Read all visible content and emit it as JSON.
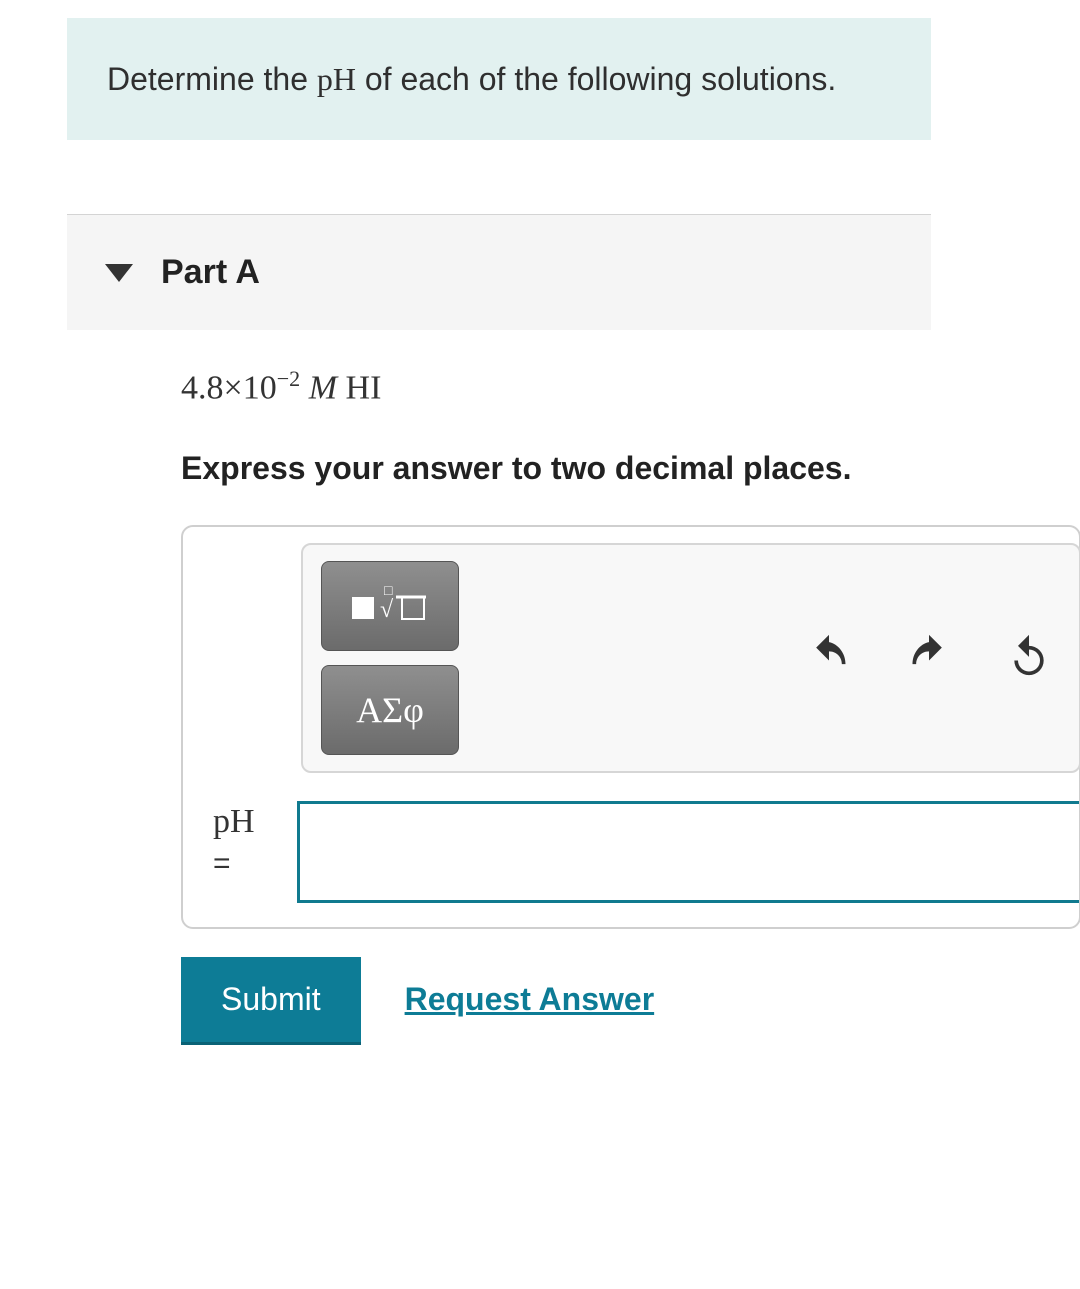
{
  "prompt": {
    "prefix": "Determine the ",
    "ph": "pH",
    "suffix": " of each of the following solutions."
  },
  "part": {
    "label": "Part A",
    "formula": {
      "coefficient": "4.8",
      "times": "×",
      "base": "10",
      "exponent": "−2",
      "space": " ",
      "molarity": "M",
      "compound": " HI"
    },
    "instruction": "Express your answer to two decimal places."
  },
  "toolbar": {
    "template_btn": "templates",
    "greek_btn": "ΑΣφ",
    "icons": {
      "templates": "templates-icon",
      "greek": "greek-letters-icon",
      "undo": "undo-icon",
      "redo": "redo-icon",
      "reset": "reset-icon"
    }
  },
  "answer": {
    "label_var": "pH",
    "label_eq": "=",
    "value": ""
  },
  "actions": {
    "submit": "Submit",
    "request": "Request Answer"
  }
}
